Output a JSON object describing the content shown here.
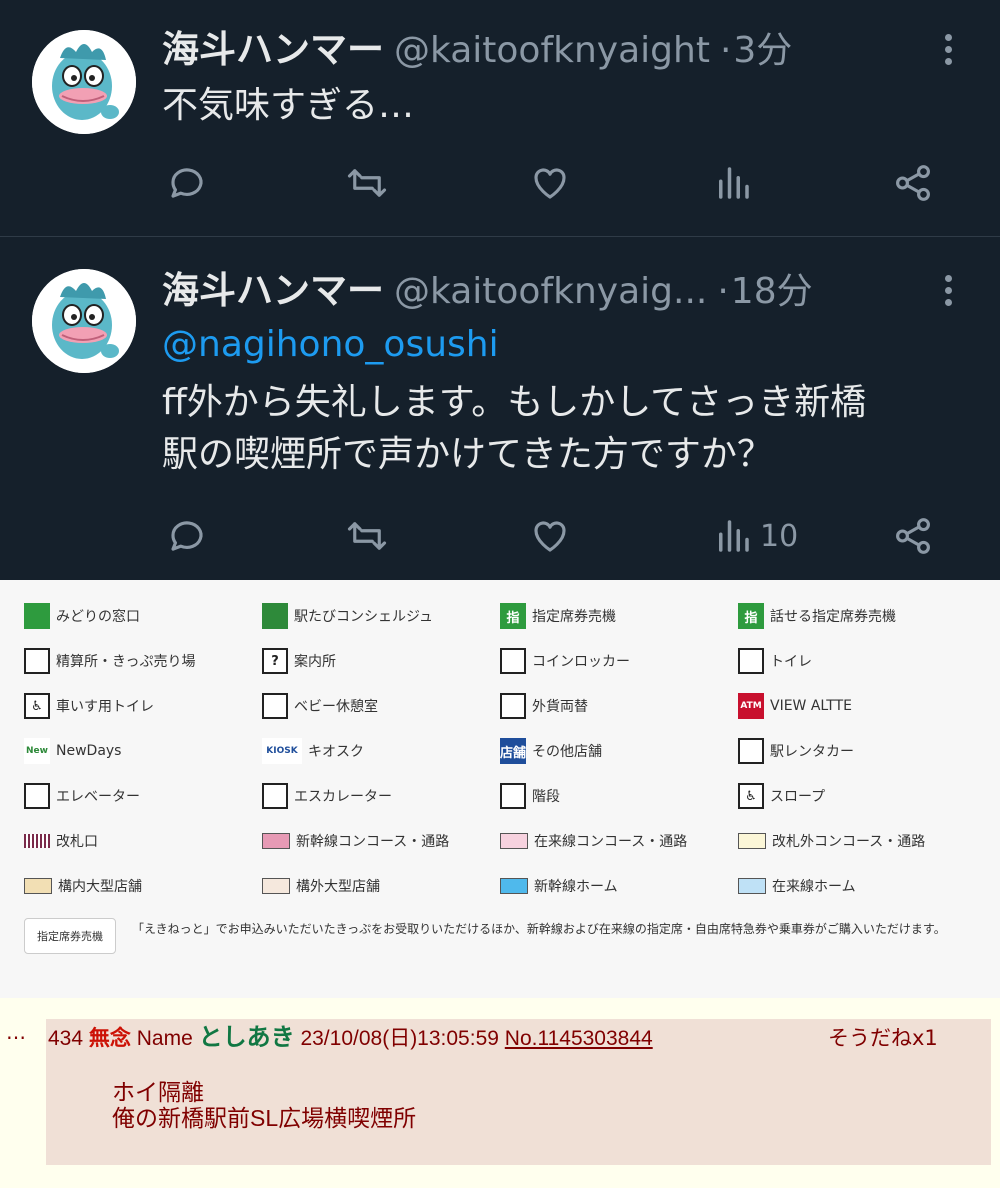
{
  "tweets": [
    {
      "name": "海斗ハンマー",
      "handle": "@kaitoofknyaight",
      "time": "3分",
      "text": "不気味すぎる…",
      "views": ""
    },
    {
      "name": "海斗ハンマー",
      "handle": "@kaitoofknyaig...",
      "time": "18分",
      "mention": "@nagihono_osushi",
      "text_line1": "ff外から失礼します。もしかしてさっき新橋",
      "text_line2": "駅の喫煙所で声かけてきた方ですか？",
      "views": "10"
    }
  ],
  "legend": {
    "items": [
      {
        "label": "みどりの窓口",
        "icon": "midori-window-icon"
      },
      {
        "label": "駅たびコンシェルジュ",
        "icon": "bookmark-icon"
      },
      {
        "label": "指定席券売機",
        "icon": "reserved-ticket-machine-icon",
        "glyph": "指"
      },
      {
        "label": "話せる指定席券売機",
        "icon": "talking-ticket-machine-icon",
        "glyph": "指"
      },
      {
        "label": "精算所・きっぷ売り場",
        "icon": "fare-adjustment-icon"
      },
      {
        "label": "案内所",
        "icon": "question-icon",
        "glyph": "?"
      },
      {
        "label": "コインロッカー",
        "icon": "coin-locker-icon"
      },
      {
        "label": "トイレ",
        "icon": "toilet-icon"
      },
      {
        "label": "車いす用トイレ",
        "icon": "wheelchair-icon",
        "glyph": "♿"
      },
      {
        "label": "ベビー休憩室",
        "icon": "baby-room-icon"
      },
      {
        "label": "外貨両替",
        "icon": "currency-exchange-icon"
      },
      {
        "label": "VIEW ALTTE",
        "icon": "atm-icon",
        "glyph": "ATM"
      },
      {
        "label": "NewDays",
        "icon": "newdays-logo-icon"
      },
      {
        "label": "キオスク",
        "icon": "kiosk-logo-icon",
        "glyph": "KIOSK"
      },
      {
        "label": "その他店舗",
        "icon": "shop-icon",
        "glyph": "店舗"
      },
      {
        "label": "駅レンタカー",
        "icon": "rent-a-car-icon"
      },
      {
        "label": "エレベーター",
        "icon": "elevator-icon"
      },
      {
        "label": "エスカレーター",
        "icon": "escalator-icon"
      },
      {
        "label": "階段",
        "icon": "stairs-icon"
      },
      {
        "label": "スロープ",
        "icon": "slope-icon",
        "glyph": "♿"
      },
      {
        "label": "改札口",
        "icon": "ticket-gate-icon"
      },
      {
        "label": "新幹線コンコース・通路",
        "swatch": "#e79ab5"
      },
      {
        "label": "在来線コンコース・通路",
        "swatch": "#f7d2df"
      },
      {
        "label": "改札外コンコース・通路",
        "swatch": "#fbf6d7"
      },
      {
        "label": "構内大型店舗",
        "swatch": "#f2dfb4"
      },
      {
        "label": "構外大型店舗",
        "swatch": "#f5e8dd"
      },
      {
        "label": "新幹線ホーム",
        "swatch": "#4fb9ec"
      },
      {
        "label": "在来線ホーム",
        "swatch": "#bfe1f6"
      }
    ],
    "note_button": "指定席券売機",
    "note_text": "「えきねっと」でお申込みいただいたきっぷをお受取りいただけるほか、新幹線および在来線の指定席・自由席特急券や乗車券がご購入いただけます。"
  },
  "post": {
    "dots": "…",
    "number": "434",
    "subject": "無念",
    "name_label": "Name",
    "name": "としあき",
    "datetime": "23/10/08(日)13:05:59",
    "post_no": "No.1145303844",
    "soudane": "そうだねx1",
    "line1": "ホイ隔離",
    "line2": "俺の新橋駅前SL広場横喫煙所"
  },
  "colors": {
    "tweet_bg": "#15202b",
    "mention": "#1d9bf0",
    "post_bg": "#f0e0d6",
    "post_text": "#800000",
    "post_name": "#117743"
  }
}
